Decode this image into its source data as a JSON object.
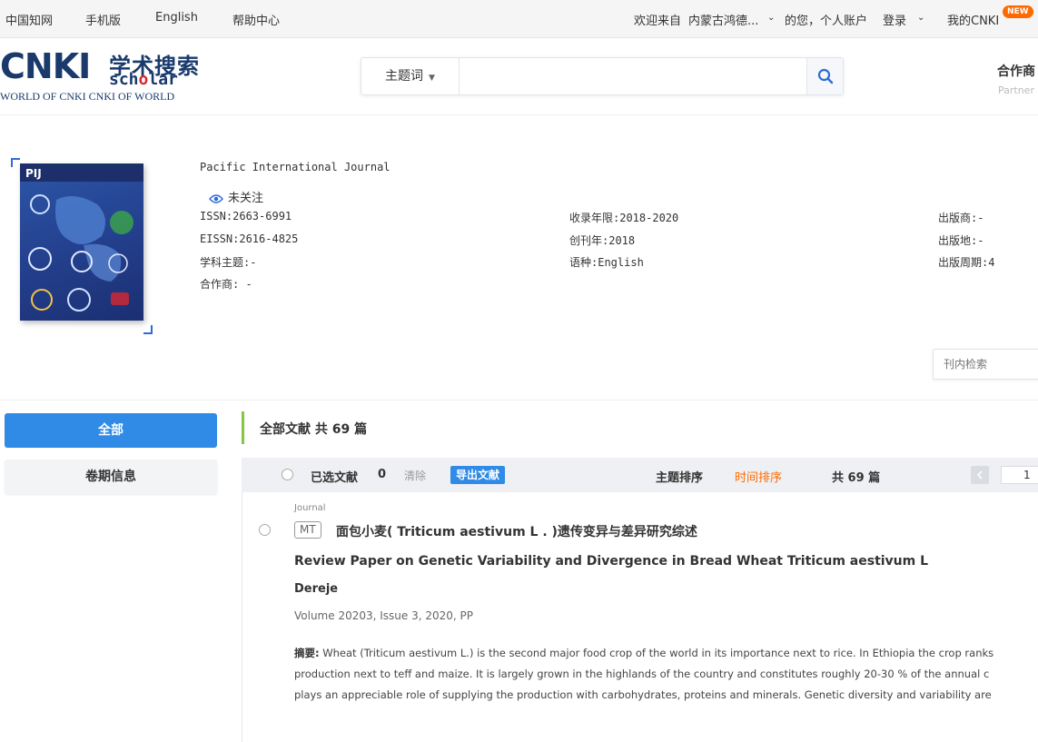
{
  "topbar": {
    "links": [
      "中国知网",
      "手机版",
      "English",
      "帮助中心"
    ],
    "welcome_prefix": "欢迎来自",
    "institution": "内蒙古鸿德...",
    "welcome_suffix": "的您，个人账户",
    "login": "登录",
    "my_cnki": "我的CNKI",
    "new_badge": "NEW"
  },
  "header": {
    "logo_main": "CNKI",
    "logo_cn": "学术搜索",
    "logo_scholar_a": "sch",
    "logo_scholar_dot": "o",
    "logo_scholar_b": "lar",
    "logo_tagline": "WORLD OF CNKI CNKI OF WORLD",
    "search_type": "主题词",
    "search_value": "",
    "partner_title": "合作商",
    "partner_sub": "Partner"
  },
  "journal": {
    "title": "Pacific International Journal",
    "follow_label": "未关注",
    "issn": "ISSN:2663-6991",
    "eissn": "EISSN:2616-4825",
    "subject": "学科主题:-",
    "partner": "合作商: -",
    "years": "收录年限:2018-2020",
    "founded": "创刊年:2018",
    "language": "语种:English",
    "publisher": "出版商:-",
    "place": "出版地:-",
    "cycle": "出版周期:4",
    "cover_label": "PIJ",
    "inside_search_placeholder": "刊内检索"
  },
  "nav": {
    "all": "全部",
    "issue_info": "卷期信息"
  },
  "list": {
    "heading": "全部文献 共 69 篇",
    "selected_label": "已选文献",
    "selected_count": "0",
    "clear": "清除",
    "export": "导出文献",
    "sort_topic": "主题排序",
    "sort_time": "时间排序",
    "total": "共 69 篇",
    "page": "1"
  },
  "item": {
    "type": "Journal",
    "tag": "MT",
    "title_cn": "面包小麦( Triticum aestivum L . )遗传变异与差异研究综述",
    "title_en": "Review Paper on Genetic Variability and Divergence in Bread Wheat Triticum aestivum L",
    "author": "Dereje",
    "volume": "Volume 20203, Issue 3, 2020, PP",
    "abstract_label": "摘要:",
    "abstract_lines": [
      "Wheat (Triticum aestivum L.) is the second major food crop of the world in its importance next to rice. In Ethiopia the crop ranks",
      "production next to teff and maize. It is largely grown in the highlands of the country and constitutes roughly 20-30 % of the annual c",
      "plays an appreciable role of supplying the production with carbohydrates, proteins and minerals. Genetic diversity and variability are"
    ]
  },
  "colors": {
    "accent": "#2f8be6",
    "orange": "#ff6a00",
    "green": "#87c543"
  }
}
